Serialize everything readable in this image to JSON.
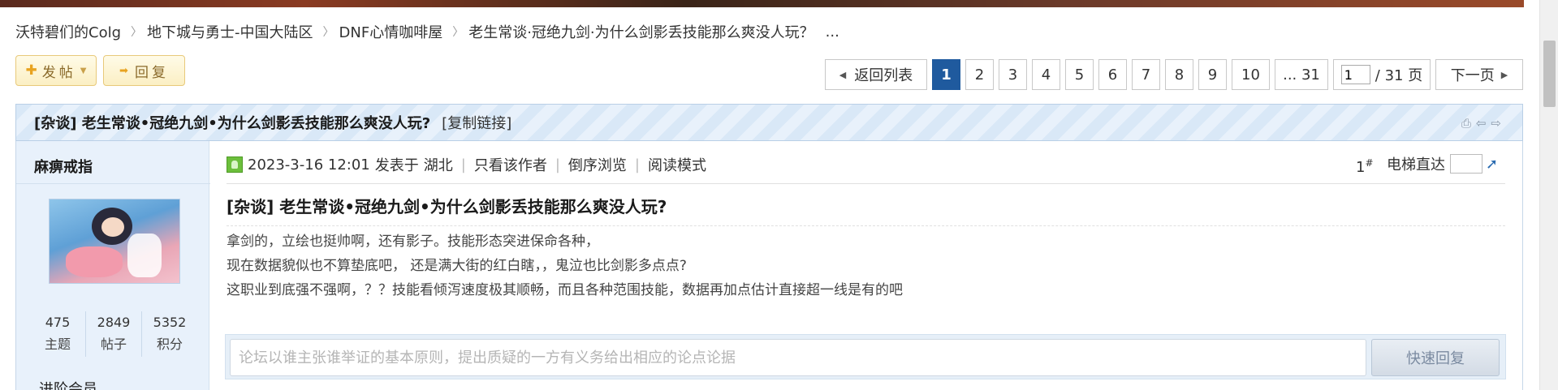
{
  "breadcrumb": {
    "items": [
      "沃特碧们的Colg",
      "地下城与勇士-中国大陆区",
      "DNF心情咖啡屋",
      "老生常谈·冠绝九剑·为什么剑影丢技能那么爽没人玩？",
      "..."
    ],
    "separator": "〉"
  },
  "toolbar": {
    "post_label": "发帖",
    "reply_label": "回复"
  },
  "pagination": {
    "back_label": "返回列表",
    "pages": [
      "1",
      "2",
      "3",
      "4",
      "5",
      "6",
      "7",
      "8",
      "9",
      "10"
    ],
    "current": "1",
    "last_label": "... 31",
    "jump_value": "1",
    "total_label": "/ 31 页",
    "next_label": "下一页"
  },
  "thread": {
    "title": "[杂谈] 老生常谈•冠绝九剑•为什么剑影丢技能那么爽没人玩?",
    "copy_link": "[复制链接]"
  },
  "author": {
    "name": "麻痹戒指",
    "stats": [
      {
        "value": "475",
        "label": "主题"
      },
      {
        "value": "2849",
        "label": "帖子"
      },
      {
        "value": "5352",
        "label": "积分"
      }
    ],
    "rank": "进阶会员"
  },
  "post": {
    "datetime": "2023-3-16 12:01",
    "posted_from": "发表于",
    "location": "湖北",
    "actions": [
      "只看该作者",
      "倒序浏览",
      "阅读模式"
    ],
    "floor_number": "1",
    "floor_symbol": "#",
    "elevator_label": "电梯直达",
    "title": "[杂谈] 老生常谈•冠绝九剑•为什么剑影丢技能那么爽没人玩?",
    "lines": [
      "拿剑的，立绘也挺帅啊，还有影子。技能形态突进保命各种，",
      "现在数据貌似也不算垫底吧，  还是满大街的红白瞎，，鬼泣也比剑影多点点?",
      "这职业到底强不强啊，？？技能看倾泻速度极其顺畅，而且各种范围技能，数据再加点估计直接超一线是有的吧"
    ]
  },
  "quick_reply": {
    "placeholder": "论坛以谁主张谁举证的基本原则，提出质疑的一方有义务给出相应的论点论据",
    "button_label": "快速回复"
  },
  "colors": {
    "accent": "#1f5a9e",
    "header_bg": "#d9e8f7",
    "author_bg": "#e8f1fb",
    "button_gold": "#e8a320"
  }
}
